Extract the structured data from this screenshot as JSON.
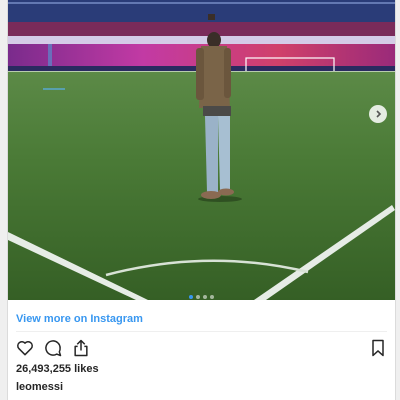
{
  "post": {
    "view_more_label": "View more on Instagram",
    "likes_text": "26,493,255 likes",
    "username": "leomessi",
    "carousel": {
      "slides": 4,
      "active_index": 0
    }
  },
  "icons": {
    "like": "heart-outline-icon",
    "comment": "speech-bubble-icon",
    "share": "share-icon",
    "save": "bookmark-icon",
    "next": "chevron-right-icon"
  },
  "colors": {
    "link_blue": "#3897f0",
    "text_dark": "#262626",
    "pitch_green": "#3f6b2c",
    "stand_magenta": "#c23aa4"
  }
}
